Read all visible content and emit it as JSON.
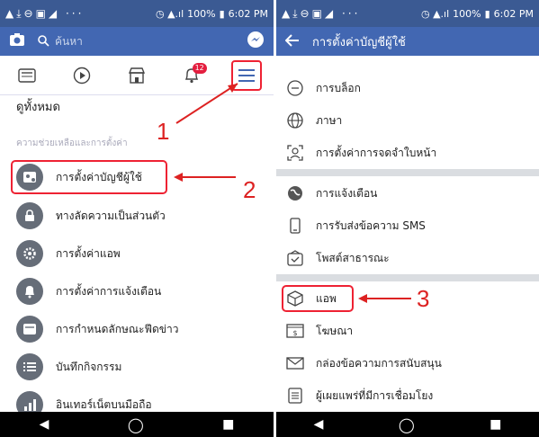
{
  "status": {
    "time": "6:02 PM",
    "battery": "100%"
  },
  "left": {
    "search_placeholder": "ค้นหา",
    "badge": "12",
    "see_all": "ดูทั้งหมด",
    "section_label": "ความช่วยเหลือและการตั้งค่า",
    "items": [
      "การตั้งค่าบัญชีผู้ใช้",
      "ทางลัดความเป็นส่วนตัว",
      "การตั้งค่าแอพ",
      "การตั้งค่าการแจ้งเตือน",
      "การกำหนดลักษณะฟีดข่าว",
      "บันทึกกิจกรรม",
      "อินเทอร์เน็ตบนมือถือ"
    ],
    "annotation_1": "1",
    "annotation_2": "2"
  },
  "right": {
    "title": "การตั้งค่าบัญชีผู้ใช้",
    "items": [
      "การบล็อก",
      "ภาษา",
      "การตั้งค่าการจดจำใบหน้า",
      "การแจ้งเตือน",
      "การรับส่งข้อความ SMS",
      "โพสต์สาธารณะ",
      "แอพ",
      "โฆษณา",
      "กล่องข้อความการสนับสนุน",
      "ผู้เผยแพร่ที่มีการเชื่อมโยง"
    ],
    "annotation_3": "3"
  }
}
